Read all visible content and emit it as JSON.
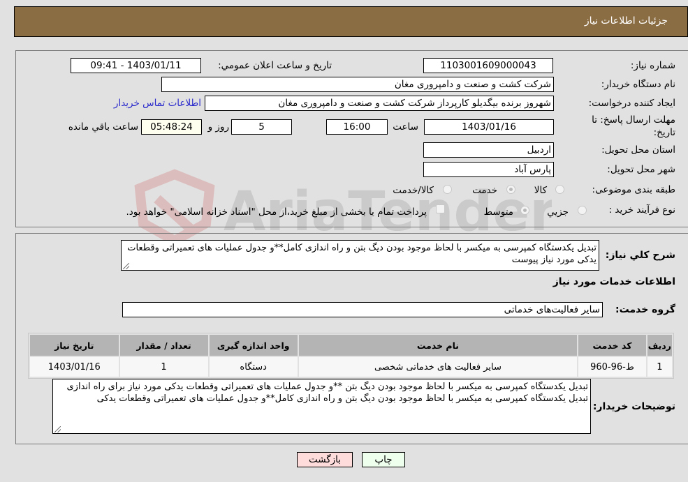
{
  "header": {
    "title": "جزئیات اطلاعات نیاز"
  },
  "form": {
    "need_number": {
      "label": "شماره نیاز:",
      "value": "1103001609000043"
    },
    "announce_datetime": {
      "label": "تاریخ و ساعت اعلان عمومي:",
      "value": "1403/01/11 - 09:41"
    },
    "buyer_org": {
      "label": "نام دستگاه خریدار:",
      "value": "شرکت کشت و صنعت و دامپروری مغان"
    },
    "requester": {
      "label": "ایجاد کننده درخواست:",
      "value": "شهروز برنده بیگدیلو کارپرداز شرکت کشت و صنعت و دامپروری مغان",
      "contact_link": "اطلاعات تماس خریدار"
    },
    "deadline": {
      "label": "مهلت ارسال پاسخ: تا تاریخ:",
      "date": "1403/01/16",
      "time_label": "ساعت",
      "time": "16:00",
      "days": "5",
      "days_label": "روز و",
      "remaining": "05:48:24",
      "remaining_label": "ساعت باقي مانده"
    },
    "province": {
      "label": "استان محل تحویل:",
      "value": "اردبیل"
    },
    "city": {
      "label": "شهر محل تحویل:",
      "value": "پارس آباد"
    },
    "category": {
      "label": "طبقه بندی موضوعی:",
      "options": [
        {
          "label": "کالا",
          "checked": false
        },
        {
          "label": "خدمت",
          "checked": true
        },
        {
          "label": "کالا/خدمت",
          "checked": false
        }
      ]
    },
    "purchase_process": {
      "label": "نوع فرآیند خرید :",
      "options": [
        {
          "label": "جزیي",
          "checked": false
        },
        {
          "label": "متوسط",
          "checked": true
        }
      ],
      "treasury_checkbox_label": "پرداخت تمام یا بخشی از مبلغ خرید،از محل \"اسناد خزانه اسلامی\" خواهد بود.",
      "treasury_checked": false
    }
  },
  "details": {
    "general_desc_label": "شرح کلي نیاز:",
    "general_desc": "تبدیل یکدستگاه کمپرسی به میکسر  با لحاظ موجود بودن دیگ بتن و راه اندازی کامل**و جدول عملیات های تعمیراتی وقطعات یدکی مورد نیاز پیوست",
    "services_heading": "اطلاعات خدمات مورد نیاز",
    "service_group_label": "گروه خدمت:",
    "service_group": "سایر فعالیت‌های خدماتی",
    "table": {
      "headers": [
        "ردیف",
        "کد خدمت",
        "نام خدمت",
        "واحد اندازه گیری",
        "تعداد / مقدار",
        "تاریخ نیاز"
      ],
      "rows": [
        [
          "1",
          "ط-96-960",
          "سایر فعالیت های خدماتی شخصی",
          "دستگاه",
          "1",
          "1403/01/16"
        ]
      ]
    },
    "buyer_notes_label": "توضیحات خریدار:",
    "buyer_notes": "تبدیل یکدستگاه کمپرسی به میکسر  با لحاظ موجود بودن دیگ بتن **و جدول عملیات های تعمیراتی وقطعات یدکی مورد نیاز برای راه اندازی تبدیل یکدستگاه کمپرسی به میکسر  با لحاظ موجود بودن دیگ بتن و راه اندازی کامل**و جدول عملیات های تعمیراتی وقطعات یدکی"
  },
  "buttons": {
    "print": "چاپ",
    "back": "بازگشت"
  },
  "watermark": {
    "text": "AriaTender.neT"
  }
}
